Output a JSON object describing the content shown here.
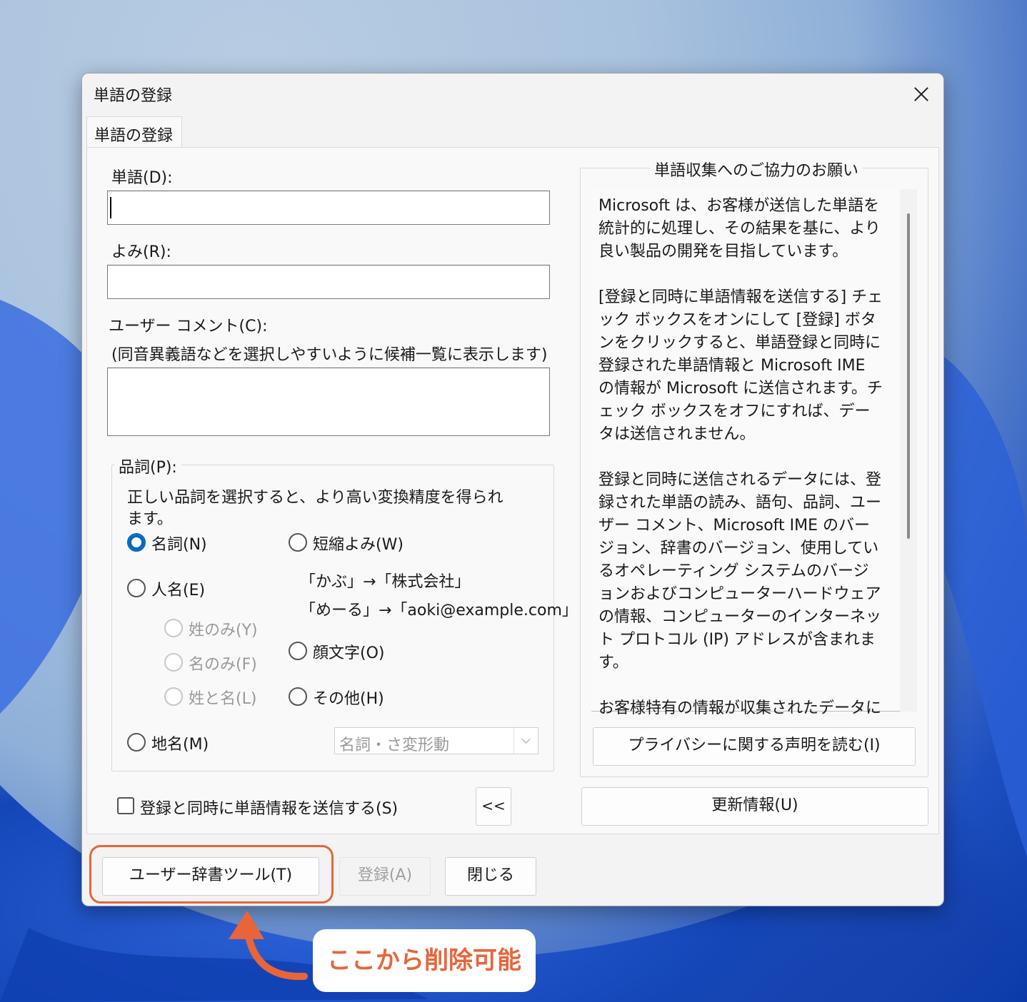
{
  "dialog": {
    "title": "単語の登録",
    "tab_label": "単語の登録"
  },
  "form": {
    "word_label": "単語(D):",
    "word_value": "",
    "reading_label": "よみ(R):",
    "reading_value": "",
    "comment_label": "ユーザー コメント(C):",
    "comment_hint": "(同音異義語などを選択しやすいように候補一覧に表示します)",
    "comment_value": ""
  },
  "pos": {
    "legend": "品詞(P):",
    "description": "正しい品詞を選択すると、より高い変換精度を得られます。",
    "noun": "名詞(N)",
    "person": "人名(E)",
    "surname_only": "姓のみ(Y)",
    "given_only": "名のみ(F)",
    "full_name": "姓と名(L)",
    "place": "地名(M)",
    "abbrev": "短縮よみ(W)",
    "abbrev_example1": "「かぶ」→「株式会社」",
    "abbrev_example2": "「めーる」→「aoki@example.com」",
    "emoticon": "顔文字(O)",
    "other": "その他(H)",
    "combo_value": "名詞・さ変形動",
    "selected": "名詞(N)"
  },
  "send_checkbox_label": "登録と同時に単語情報を送信する(S)",
  "collapse_button": "<<",
  "info": {
    "legend": "単語収集へのご協力のお願い",
    "paragraphs": [
      "Microsoft は、お客様が送信した単語を統計的に処理し、その結果を基に、より良い製品の開発を目指しています。",
      "[登録と同時に単語情報を送信する] チェック ボックスをオンにして [登録] ボタンをクリックすると、単語登録と同時に登録された単語情報と Microsoft IME の情報が Microsoft に送信されます。チェック ボックスをオフにすれば、データは送信されません。",
      "登録と同時に送信されるデータには、登録された単語の読み、語句、品詞、ユーザー コメント、Microsoft IME のバージョン、辞書のバージョン、使用しているオペレーティング システムのバージョンおよびコンピューターハードウェアの情報、コンピューターのインターネット プロトコル (IP) アドレスが含まれます。",
      "お客様特有の情報が収集されたデータに含まれることがあります。このような情報が存在する場合でも、Microsoft では、お客様を特定するために使用することはありません。"
    ],
    "privacy_button": "プライバシーに関する声明を読む(I)"
  },
  "update_button": "更新情報(U)",
  "footer": {
    "dictionary_tool": "ユーザー辞書ツール(T)",
    "register": "登録(A)",
    "close": "閉じる"
  },
  "annotation": {
    "callout_text": "ここから削除可能",
    "color": "#e8653a"
  }
}
